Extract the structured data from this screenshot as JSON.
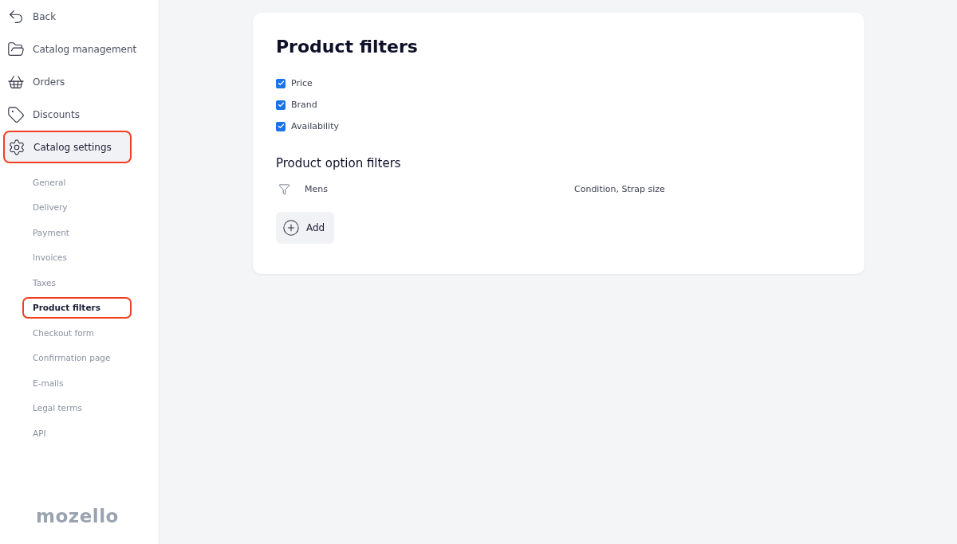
{
  "sidebar": {
    "nav": [
      {
        "kind": "back",
        "label": "Back",
        "selected": false,
        "highlighted": false
      },
      {
        "kind": "catalog",
        "label": "Catalog management",
        "selected": false,
        "highlighted": false
      },
      {
        "kind": "orders",
        "label": "Orders",
        "selected": false,
        "highlighted": false
      },
      {
        "kind": "discounts",
        "label": "Discounts",
        "selected": false,
        "highlighted": false
      },
      {
        "kind": "settings",
        "label": "Catalog settings",
        "selected": true,
        "highlighted": true
      }
    ],
    "subnav": [
      {
        "label": "General",
        "selected": false,
        "highlighted": false
      },
      {
        "label": "Delivery",
        "selected": false,
        "highlighted": false
      },
      {
        "label": "Payment",
        "selected": false,
        "highlighted": false
      },
      {
        "label": "Invoices",
        "selected": false,
        "highlighted": false
      },
      {
        "label": "Taxes",
        "selected": false,
        "highlighted": false
      },
      {
        "label": "Product filters",
        "selected": true,
        "highlighted": true
      },
      {
        "label": "Checkout form",
        "selected": false,
        "highlighted": false
      },
      {
        "label": "Confirmation page",
        "selected": false,
        "highlighted": false
      },
      {
        "label": "E-mails",
        "selected": false,
        "highlighted": false
      },
      {
        "label": "Legal terms",
        "selected": false,
        "highlighted": false
      },
      {
        "label": "API",
        "selected": false,
        "highlighted": false
      }
    ],
    "logo": "mozello"
  },
  "page": {
    "title": "Product filters",
    "filters": [
      {
        "label": "Price",
        "checked": true
      },
      {
        "label": "Brand",
        "checked": true
      },
      {
        "label": "Availability",
        "checked": true
      }
    ],
    "option_section": {
      "title": "Product option filters",
      "rows": [
        {
          "name": "Mens",
          "options": "Condition, Strap size"
        }
      ],
      "add_button": "Add"
    }
  }
}
